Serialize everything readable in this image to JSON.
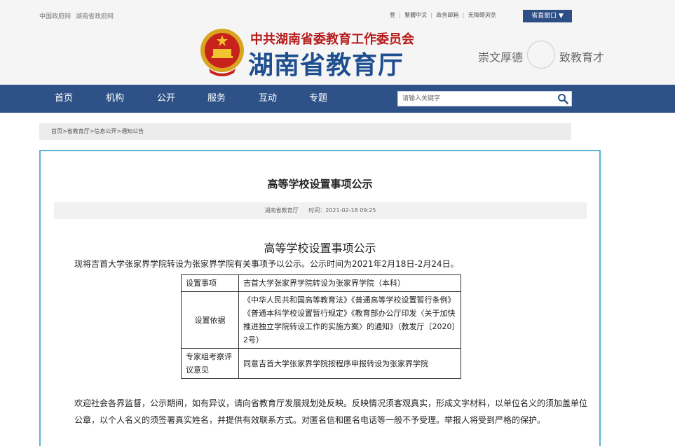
{
  "topbar": {
    "left_links": [
      "中国政府网",
      "湖南省政府网"
    ],
    "right_links": [
      "登",
      "繁體中文",
      "政务邮箱",
      "无障碍浏览"
    ],
    "site_button": "省直窗口 ▼"
  },
  "header": {
    "org_name": "中共湖南省委教育工作委员会",
    "dept_name": "湖南省教育厅",
    "slogan_left": "崇文厚德",
    "slogan_right": "致教育才"
  },
  "nav": {
    "items": [
      "首页",
      "机构",
      "公开",
      "服务",
      "互动",
      "专题"
    ]
  },
  "search": {
    "placeholder": "请输入关键字"
  },
  "breadcrumb": "首页>省教育厅>信息公开>通知公告",
  "article": {
    "title": "高等学校设置事项公示",
    "source": "湖南省教育厅",
    "time": "时间：2021-02-18 09:25",
    "content_title": "高等学校设置事项公示",
    "intro": "现将吉首大学张家界学院转设为张家界学院有关事项予以公示。公示时间为2021年2月18日-2月24日。",
    "table": [
      {
        "label": "设置事项",
        "value": "吉首大学张家界学院转设为张家界学院（本科）"
      },
      {
        "label": "设置依据",
        "value": "《中华人民共和国高等教育法》《普通高等学校设置暂行条例》《普通本科学校设置暂行规定》《教育部办公厅印发〈关于加快推进独立学院转设工作的实施方案〉的通知》（教发厅〔2020〕2号）"
      },
      {
        "label": "专家组考察评议意见",
        "value": "同意吉首大学张家界学院按程序申报转设为张家界学院"
      }
    ],
    "closing": "欢迎社会各界监督，公示期间，如有异议，请向省教育厅发展规划处反映。反映情况须客观真实，形成文字材料，以单位名义的须加盖单位公章，以个人名义的须签署真实姓名，并提供有效联系方式。对匿名信和匿名电话等一般不予受理。举报人将受到严格的保护。"
  },
  "colors": {
    "nav_bg": "#2e5287",
    "brand_blue": "#1f4f8f",
    "brand_red": "#b51b1b",
    "article_border": "#5cb0d6"
  }
}
